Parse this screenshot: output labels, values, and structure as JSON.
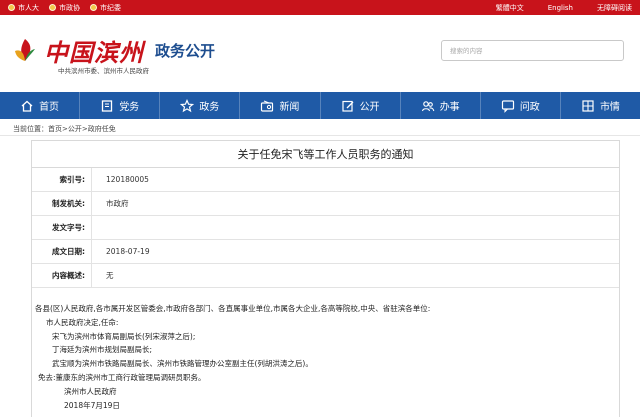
{
  "topbar": {
    "links": [
      {
        "icon": "emblem-icon",
        "label": "市人大"
      },
      {
        "icon": "emblem-icon",
        "label": "市政协"
      },
      {
        "icon": "emblem-icon",
        "label": "市纪委"
      }
    ],
    "right": {
      "traditional": "繁體中文",
      "english": "English",
      "accessibility": "无障碍阅读"
    }
  },
  "header": {
    "logo_text": "中国滨州",
    "subtitle": "政务公开",
    "org": "中共滨州市委、滨州市人民政府",
    "search_placeholder": "搜索的内容"
  },
  "nav": [
    {
      "icon": "home-icon",
      "label": "首页"
    },
    {
      "icon": "book-icon",
      "label": "党务"
    },
    {
      "icon": "star-icon",
      "label": "政务"
    },
    {
      "icon": "radio-icon",
      "label": "新闻"
    },
    {
      "icon": "edit-icon",
      "label": "公开"
    },
    {
      "icon": "people-icon",
      "label": "办事"
    },
    {
      "icon": "chat-icon",
      "label": "问政"
    },
    {
      "icon": "grid-icon",
      "label": "市情"
    }
  ],
  "breadcrumb": "当前位置：首页>公开>政府任免",
  "article": {
    "title": "关于任免宋飞等工作人员职务的通知",
    "meta": [
      {
        "key": "索引号:",
        "value": "120180005"
      },
      {
        "key": "制发机关:",
        "value": "市政府"
      },
      {
        "key": "发文字号:",
        "value": ""
      },
      {
        "key": "成文日期:",
        "value": "2018-07-19"
      },
      {
        "key": "内容概述:",
        "value": "无"
      }
    ],
    "body": [
      "各县(区)人民政府,各市属开发区管委会,市政府各部门、各直属事业单位,市属各大企业,各高等院校,中央、省驻滨各单位:",
      "市人民政府决定,任命:",
      "宋飞为滨州市体育局副局长(列宋淑萍之后);",
      "丁海廷为滨州市规划局副局长;",
      "武宝顺为滨州市铁路局副局长、滨州市铁路管理办公室副主任(列胡洪涛之后)。",
      "免去:董康东的滨州市工商行政管理局调研员职务。",
      "滨州市人民政府",
      "2018年7月19日"
    ]
  },
  "colors": {
    "topbar": "#c8131b",
    "nav": "#1f5aa6",
    "brand_red": "#c8131b",
    "brand_blue": "#1d4d8f"
  }
}
